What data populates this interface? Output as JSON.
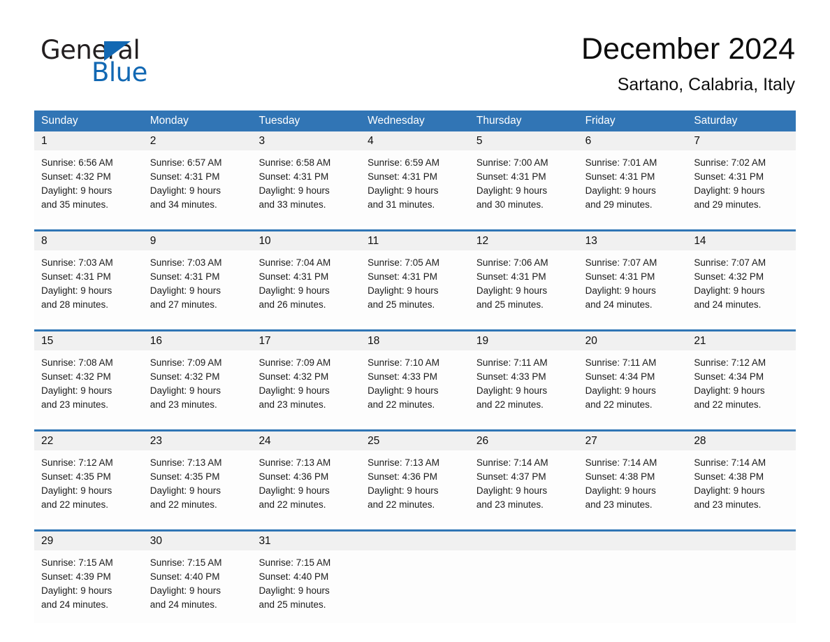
{
  "brand": {
    "name_part1": "General",
    "name_part2": "Blue",
    "logo_icon": "triangle-flag-icon"
  },
  "header": {
    "title": "December 2024",
    "subtitle": "Sartano, Calabria, Italy"
  },
  "colors": {
    "header_blue": "#3175b5",
    "row_separator_blue": "#2f75b5",
    "daynum_band": "#f0f0f0",
    "brand_blue": "#1268b3",
    "text": "#0d0d0d"
  },
  "weekdays": [
    "Sunday",
    "Monday",
    "Tuesday",
    "Wednesday",
    "Thursday",
    "Friday",
    "Saturday"
  ],
  "weeks": [
    {
      "days": [
        {
          "num": "1",
          "sunrise": "Sunrise: 6:56 AM",
          "sunset": "Sunset: 4:32 PM",
          "daylight_line1": "Daylight: 9 hours",
          "daylight_line2": "and 35 minutes."
        },
        {
          "num": "2",
          "sunrise": "Sunrise: 6:57 AM",
          "sunset": "Sunset: 4:31 PM",
          "daylight_line1": "Daylight: 9 hours",
          "daylight_line2": "and 34 minutes."
        },
        {
          "num": "3",
          "sunrise": "Sunrise: 6:58 AM",
          "sunset": "Sunset: 4:31 PM",
          "daylight_line1": "Daylight: 9 hours",
          "daylight_line2": "and 33 minutes."
        },
        {
          "num": "4",
          "sunrise": "Sunrise: 6:59 AM",
          "sunset": "Sunset: 4:31 PM",
          "daylight_line1": "Daylight: 9 hours",
          "daylight_line2": "and 31 minutes."
        },
        {
          "num": "5",
          "sunrise": "Sunrise: 7:00 AM",
          "sunset": "Sunset: 4:31 PM",
          "daylight_line1": "Daylight: 9 hours",
          "daylight_line2": "and 30 minutes."
        },
        {
          "num": "6",
          "sunrise": "Sunrise: 7:01 AM",
          "sunset": "Sunset: 4:31 PM",
          "daylight_line1": "Daylight: 9 hours",
          "daylight_line2": "and 29 minutes."
        },
        {
          "num": "7",
          "sunrise": "Sunrise: 7:02 AM",
          "sunset": "Sunset: 4:31 PM",
          "daylight_line1": "Daylight: 9 hours",
          "daylight_line2": "and 29 minutes."
        }
      ]
    },
    {
      "days": [
        {
          "num": "8",
          "sunrise": "Sunrise: 7:03 AM",
          "sunset": "Sunset: 4:31 PM",
          "daylight_line1": "Daylight: 9 hours",
          "daylight_line2": "and 28 minutes."
        },
        {
          "num": "9",
          "sunrise": "Sunrise: 7:03 AM",
          "sunset": "Sunset: 4:31 PM",
          "daylight_line1": "Daylight: 9 hours",
          "daylight_line2": "and 27 minutes."
        },
        {
          "num": "10",
          "sunrise": "Sunrise: 7:04 AM",
          "sunset": "Sunset: 4:31 PM",
          "daylight_line1": "Daylight: 9 hours",
          "daylight_line2": "and 26 minutes."
        },
        {
          "num": "11",
          "sunrise": "Sunrise: 7:05 AM",
          "sunset": "Sunset: 4:31 PM",
          "daylight_line1": "Daylight: 9 hours",
          "daylight_line2": "and 25 minutes."
        },
        {
          "num": "12",
          "sunrise": "Sunrise: 7:06 AM",
          "sunset": "Sunset: 4:31 PM",
          "daylight_line1": "Daylight: 9 hours",
          "daylight_line2": "and 25 minutes."
        },
        {
          "num": "13",
          "sunrise": "Sunrise: 7:07 AM",
          "sunset": "Sunset: 4:31 PM",
          "daylight_line1": "Daylight: 9 hours",
          "daylight_line2": "and 24 minutes."
        },
        {
          "num": "14",
          "sunrise": "Sunrise: 7:07 AM",
          "sunset": "Sunset: 4:32 PM",
          "daylight_line1": "Daylight: 9 hours",
          "daylight_line2": "and 24 minutes."
        }
      ]
    },
    {
      "days": [
        {
          "num": "15",
          "sunrise": "Sunrise: 7:08 AM",
          "sunset": "Sunset: 4:32 PM",
          "daylight_line1": "Daylight: 9 hours",
          "daylight_line2": "and 23 minutes."
        },
        {
          "num": "16",
          "sunrise": "Sunrise: 7:09 AM",
          "sunset": "Sunset: 4:32 PM",
          "daylight_line1": "Daylight: 9 hours",
          "daylight_line2": "and 23 minutes."
        },
        {
          "num": "17",
          "sunrise": "Sunrise: 7:09 AM",
          "sunset": "Sunset: 4:32 PM",
          "daylight_line1": "Daylight: 9 hours",
          "daylight_line2": "and 23 minutes."
        },
        {
          "num": "18",
          "sunrise": "Sunrise: 7:10 AM",
          "sunset": "Sunset: 4:33 PM",
          "daylight_line1": "Daylight: 9 hours",
          "daylight_line2": "and 22 minutes."
        },
        {
          "num": "19",
          "sunrise": "Sunrise: 7:11 AM",
          "sunset": "Sunset: 4:33 PM",
          "daylight_line1": "Daylight: 9 hours",
          "daylight_line2": "and 22 minutes."
        },
        {
          "num": "20",
          "sunrise": "Sunrise: 7:11 AM",
          "sunset": "Sunset: 4:34 PM",
          "daylight_line1": "Daylight: 9 hours",
          "daylight_line2": "and 22 minutes."
        },
        {
          "num": "21",
          "sunrise": "Sunrise: 7:12 AM",
          "sunset": "Sunset: 4:34 PM",
          "daylight_line1": "Daylight: 9 hours",
          "daylight_line2": "and 22 minutes."
        }
      ]
    },
    {
      "days": [
        {
          "num": "22",
          "sunrise": "Sunrise: 7:12 AM",
          "sunset": "Sunset: 4:35 PM",
          "daylight_line1": "Daylight: 9 hours",
          "daylight_line2": "and 22 minutes."
        },
        {
          "num": "23",
          "sunrise": "Sunrise: 7:13 AM",
          "sunset": "Sunset: 4:35 PM",
          "daylight_line1": "Daylight: 9 hours",
          "daylight_line2": "and 22 minutes."
        },
        {
          "num": "24",
          "sunrise": "Sunrise: 7:13 AM",
          "sunset": "Sunset: 4:36 PM",
          "daylight_line1": "Daylight: 9 hours",
          "daylight_line2": "and 22 minutes."
        },
        {
          "num": "25",
          "sunrise": "Sunrise: 7:13 AM",
          "sunset": "Sunset: 4:36 PM",
          "daylight_line1": "Daylight: 9 hours",
          "daylight_line2": "and 22 minutes."
        },
        {
          "num": "26",
          "sunrise": "Sunrise: 7:14 AM",
          "sunset": "Sunset: 4:37 PM",
          "daylight_line1": "Daylight: 9 hours",
          "daylight_line2": "and 23 minutes."
        },
        {
          "num": "27",
          "sunrise": "Sunrise: 7:14 AM",
          "sunset": "Sunset: 4:38 PM",
          "daylight_line1": "Daylight: 9 hours",
          "daylight_line2": "and 23 minutes."
        },
        {
          "num": "28",
          "sunrise": "Sunrise: 7:14 AM",
          "sunset": "Sunset: 4:38 PM",
          "daylight_line1": "Daylight: 9 hours",
          "daylight_line2": "and 23 minutes."
        }
      ]
    },
    {
      "days": [
        {
          "num": "29",
          "sunrise": "Sunrise: 7:15 AM",
          "sunset": "Sunset: 4:39 PM",
          "daylight_line1": "Daylight: 9 hours",
          "daylight_line2": "and 24 minutes."
        },
        {
          "num": "30",
          "sunrise": "Sunrise: 7:15 AM",
          "sunset": "Sunset: 4:40 PM",
          "daylight_line1": "Daylight: 9 hours",
          "daylight_line2": "and 24 minutes."
        },
        {
          "num": "31",
          "sunrise": "Sunrise: 7:15 AM",
          "sunset": "Sunset: 4:40 PM",
          "daylight_line1": "Daylight: 9 hours",
          "daylight_line2": "and 25 minutes."
        },
        {
          "num": "",
          "sunrise": "",
          "sunset": "",
          "daylight_line1": "",
          "daylight_line2": ""
        },
        {
          "num": "",
          "sunrise": "",
          "sunset": "",
          "daylight_line1": "",
          "daylight_line2": ""
        },
        {
          "num": "",
          "sunrise": "",
          "sunset": "",
          "daylight_line1": "",
          "daylight_line2": ""
        },
        {
          "num": "",
          "sunrise": "",
          "sunset": "",
          "daylight_line1": "",
          "daylight_line2": ""
        }
      ]
    }
  ]
}
